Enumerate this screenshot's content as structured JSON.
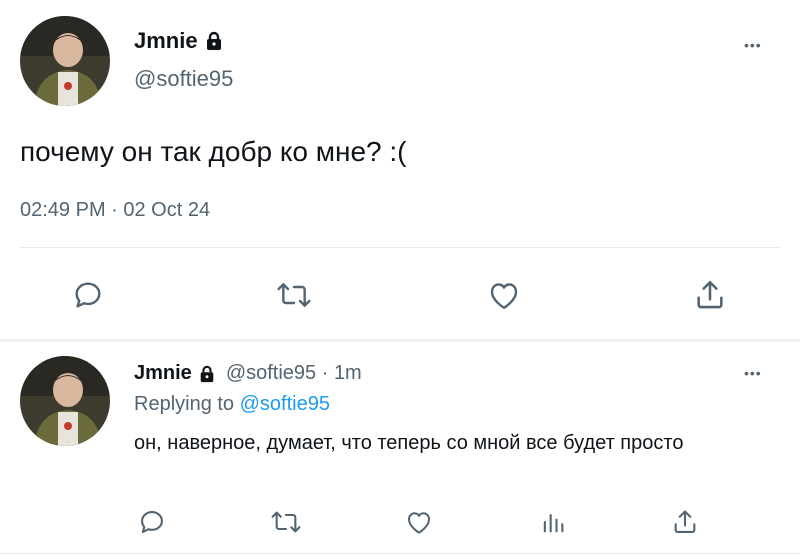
{
  "main_tweet": {
    "display_name": "Jmnie",
    "handle": "@softie95",
    "text": "почему он так добр ко мне? :(",
    "timestamp": "02:49 PM · 02 Oct 24",
    "more_label": "•••"
  },
  "reply_tweet": {
    "display_name": "Jmnie",
    "handle_time": "@softie95 · 1m",
    "replying_prefix": "Replying to",
    "replying_mention": "@softie95",
    "text": "он, наверное, думает, что теперь со мной все будет просто",
    "more_label": "•••"
  },
  "icons": [
    "lock-icon",
    "reply-icon",
    "retweet-icon",
    "like-icon",
    "share-icon",
    "analytics-icon"
  ],
  "colors": {
    "text": "#0f1419",
    "secondary": "#536471",
    "link": "#1d9bf0",
    "divider": "#e6ecf0"
  }
}
